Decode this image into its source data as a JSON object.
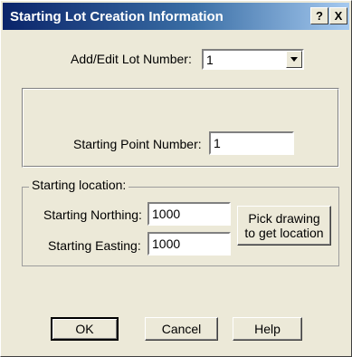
{
  "window": {
    "title": "Starting Lot Creation Information",
    "help_glyph": "?",
    "close_glyph": "X"
  },
  "lot_number": {
    "label": "Add/Edit Lot Number:",
    "value": "1"
  },
  "starting_point": {
    "label": "Starting Point Number:",
    "value": "1"
  },
  "starting_location": {
    "group_label": "Starting location:",
    "northing_label": "Starting Northing:",
    "northing_value": "1000",
    "easting_label": "Starting Easting:",
    "easting_value": "1000",
    "pick_button_line1": "Pick drawing",
    "pick_button_line2": "to get location"
  },
  "buttons": {
    "ok": "OK",
    "cancel": "Cancel",
    "help": "Help"
  }
}
